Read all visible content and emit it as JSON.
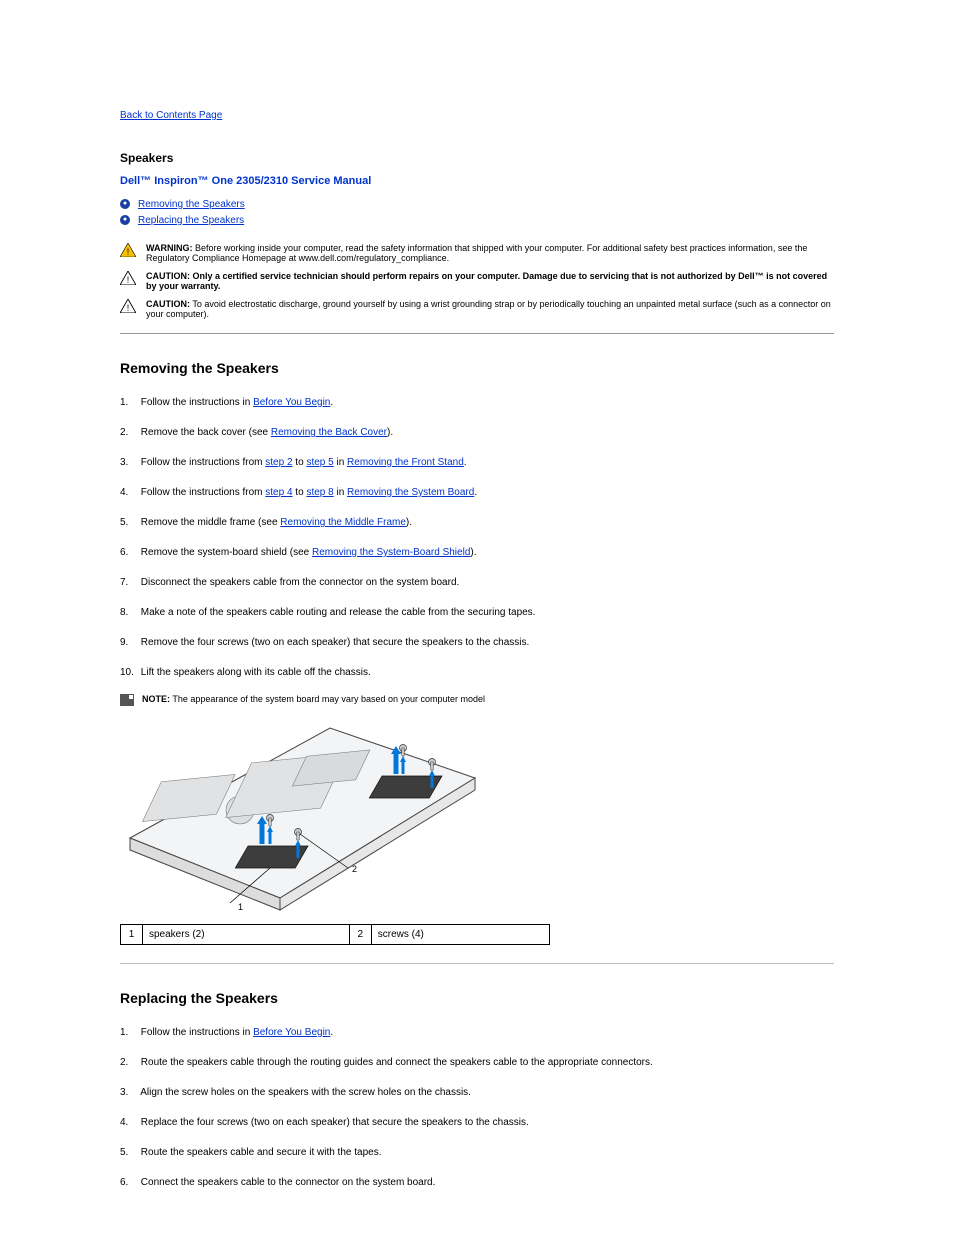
{
  "nav": {
    "back": "Back to Contents Page"
  },
  "headings": {
    "page_title": "Speakers",
    "manual_title": "Dell™ Inspiron™ One 2305/2310 Service Manual",
    "remove": "Removing the Speakers",
    "replace": "Replacing the Speakers"
  },
  "toc": {
    "remove": "Removing the Speakers",
    "replace": "Replacing the Speakers"
  },
  "alerts": {
    "warning_label": "WARNING:",
    "warning_text": "Before working inside your computer, read the safety information that shipped with your computer. For additional safety best practices information, see the Regulatory Compliance Homepage at www.dell.com/regulatory_compliance.",
    "caution1_label": "CAUTION:",
    "caution1_text": "Only a certified service technician should perform repairs on your computer. Damage due to servicing that is not authorized by Dell™ is not covered by your warranty.",
    "caution2_label": "CAUTION:",
    "caution2_text": "To avoid electrostatic discharge, ground yourself by using a wrist grounding strap or by periodically touching an unpainted metal surface (such as a connector on your computer)."
  },
  "remove_steps": {
    "s1_a": "Follow the instructions in ",
    "s1_link": "Before You Begin",
    "s1_b": ".",
    "s2_a": "Remove the back cover (see ",
    "s2_link": "Removing the Back Cover",
    "s2_b": ").",
    "s3_a": "Follow the instructions from ",
    "s3_link_a": "step 2",
    "s3_mid": " to ",
    "s3_link_b": "step 5",
    "s3_c": " in ",
    "s3_link_c": "Removing the Front Stand",
    "s3_d": ".",
    "s4_a": "Follow the instructions from ",
    "s4_link_a": "step 4",
    "s4_mid": " to ",
    "s4_link_b": "step 8",
    "s4_c": " in ",
    "s4_link_c": "Removing the System Board",
    "s4_d": ".",
    "s5_a": "Remove the middle frame (see ",
    "s5_link": "Removing the Middle Frame",
    "s5_b": ").",
    "s6_a": "Remove the system-board shield (see ",
    "s6_link": "Removing the System-Board Shield",
    "s6_b": ").",
    "s7": "Disconnect the speakers cable from the connector on the system board.",
    "s8": "Make a note of the speakers cable routing and release the cable from the securing tapes.",
    "s9": "Remove the four screws (two on each speaker) that secure the speakers to the chassis.",
    "s10": "Lift the speakers along with its cable off the chassis."
  },
  "note": {
    "label": "NOTE:",
    "text": "The appearance of the system board may vary based on your computer model"
  },
  "table": {
    "r1c1": "1",
    "r1c2": "speakers (2)",
    "r2c1": "2",
    "r2c2": "screws (4)"
  },
  "replace_steps": {
    "s1_a": "Follow the instructions in ",
    "s1_link": "Before You Begin",
    "s1_b": ".",
    "s2": "Route the speakers cable through the routing guides and connect the speakers cable to the appropriate connectors.",
    "s3": "Align the screw holes on the speakers with the screw holes on the chassis.",
    "s4": "Replace the four screws (two on each speaker) that secure the speakers to the chassis.",
    "s5": "Route the speakers cable and secure it with the tapes.",
    "s6": "Connect the speakers cable to the connector on the system board."
  },
  "diagram": {
    "callout1": "1",
    "callout2": "2"
  }
}
